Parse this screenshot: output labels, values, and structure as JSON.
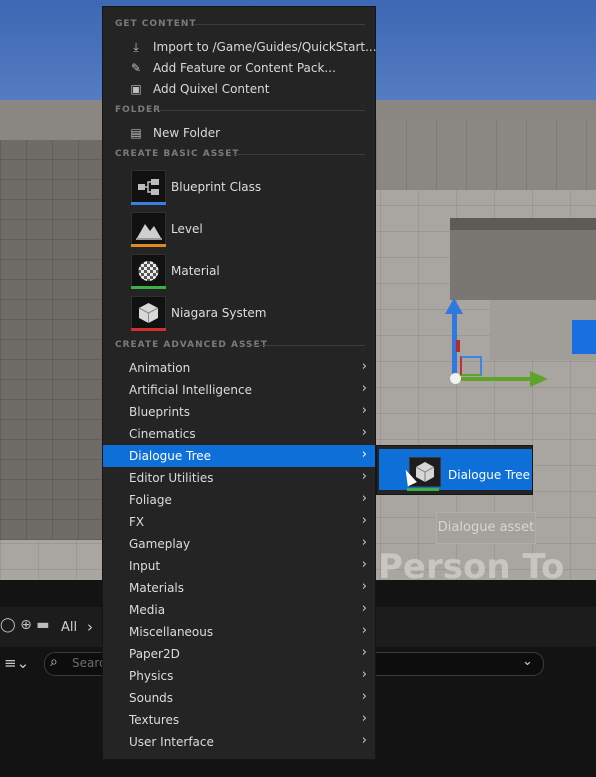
{
  "menu": {
    "sections": {
      "get_content": "GET CONTENT",
      "folder": "FOLDER",
      "basic_asset": "CREATE BASIC ASSET",
      "advanced_asset": "CREATE ADVANCED ASSET"
    },
    "get_content_items": [
      {
        "label": "Import to /Game/Guides/QuickStart...",
        "icon": "import-icon"
      },
      {
        "label": "Add Feature or Content Pack...",
        "icon": "content-pack-icon"
      },
      {
        "label": "Add Quixel Content",
        "icon": "quixel-icon"
      }
    ],
    "folder_items": [
      {
        "label": "New Folder",
        "icon": "new-folder-icon"
      }
    ],
    "basic_assets": [
      {
        "label": "Blueprint Class",
        "icon": "blueprint-icon",
        "color": "#3a7ee6"
      },
      {
        "label": "Level",
        "icon": "level-icon",
        "color": "#e08a1e"
      },
      {
        "label": "Material",
        "icon": "material-icon",
        "color": "#3cb043"
      },
      {
        "label": "Niagara System",
        "icon": "niagara-icon",
        "color": "#d32f2f"
      }
    ],
    "advanced_assets": [
      "Animation",
      "Artificial Intelligence",
      "Blueprints",
      "Cinematics",
      "Dialogue Tree",
      "Editor Utilities",
      "Foliage",
      "FX",
      "Gameplay",
      "Input",
      "Materials",
      "Media",
      "Miscellaneous",
      "Paper2D",
      "Physics",
      "Sounds",
      "Textures",
      "User Interface"
    ],
    "active_advanced": "Dialogue Tree"
  },
  "submenu": {
    "label": "Dialogue Tree",
    "icon": "dialogue-tree-icon",
    "color": "#3cb043"
  },
  "viewport": {
    "asset_label": "Dialogue asset",
    "big_text": "Person To"
  },
  "content_browser": {
    "path_all": "All",
    "search_placeholder": "Search"
  },
  "colors": {
    "accent": "#0f6fd8",
    "menu_bg": "#242424"
  }
}
